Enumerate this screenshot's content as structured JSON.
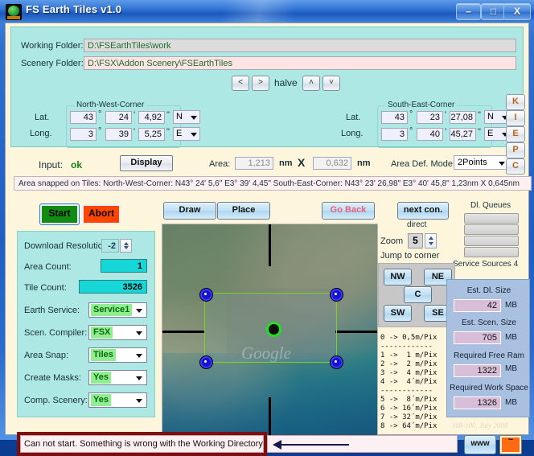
{
  "window": {
    "title": "FS Earth Tiles   v1.0",
    "minimize_label": "–",
    "maximize_label": "□",
    "close_label": "X"
  },
  "folders": {
    "working_label": "Working Folder:",
    "working_value": "D:\\FSEarthTiles\\work",
    "scenery_label": "Scenery Folder:",
    "scenery_value": "D:\\FSX\\Addon Scenery\\FSEarthTiles"
  },
  "halve": {
    "left": "<",
    "right": ">",
    "label": "halve",
    "up": "˄",
    "down": "˅"
  },
  "nw_corner": {
    "legend": "North-West-Corner",
    "lat_label": "Lat.",
    "long_label": "Long.",
    "lat_deg": "43",
    "lat_min": "24",
    "lat_sec": "4,92",
    "lat_hemi": "N",
    "long_deg": "3",
    "long_min": "39",
    "long_sec": "5,25",
    "long_hemi": "E",
    "deg_sym": "°",
    "min_sym": "'",
    "sec_sym": "\""
  },
  "se_corner": {
    "legend": "South-East-Corner",
    "lat_label": "Lat.",
    "long_label": "Long.",
    "lat_deg": "43",
    "lat_min": "23",
    "lat_sec": "27,08",
    "lat_hemi": "N",
    "long_deg": "3",
    "long_min": "40",
    "long_sec": "45,27",
    "long_hemi": "E",
    "deg_sym": "°",
    "min_sym": "'",
    "sec_sym": "\""
  },
  "input_row": {
    "input_label": "Input:",
    "input_value": "ok",
    "display_button": "Display",
    "area_label": "Area:",
    "area_width": "1,213",
    "unit1": "nm",
    "times": "X",
    "area_height": "0,632",
    "unit2": "nm",
    "mode_label": "Area Def. Mode:",
    "mode_value": "2Points"
  },
  "side_letters": [
    "K",
    "I",
    "E",
    "P",
    "C"
  ],
  "snapped_info": "Area snapped on Tiles:  North-West-Corner: N43° 24' 5,6\"  E3° 39' 4,45\"   South-East-Corner: N43° 23' 26,98\"  E3° 40' 45,8\"   1,23nm X 0,645nm",
  "actions": {
    "start": "Start",
    "abort": "Abort",
    "draw": "Draw",
    "place": "Place",
    "go_back": "Go Back",
    "next_con": "next con.",
    "direct": "direct"
  },
  "queues": {
    "label": "Dl. Queues",
    "service_sources": "Service Sources 4"
  },
  "settings": {
    "download_resolution_label": "Download Resolution:",
    "download_resolution_value": "-2",
    "area_count_label": "Area Count:",
    "area_count_value": "1",
    "tile_count_label": "Tile Count:",
    "tile_count_value": "3526",
    "earth_service_label": "Earth Service:",
    "earth_service_value": "Service1",
    "scen_compiler_label": "Scen. Compiler:",
    "scen_compiler_value": "FSX",
    "area_snap_label": "Area Snap:",
    "area_snap_value": "Tiles",
    "create_masks_label": "Create Masks:",
    "create_masks_value": "Yes",
    "comp_scenery_label": "Comp. Scenery:",
    "comp_scenery_value": "Yes"
  },
  "map": {
    "watermark": "Google"
  },
  "zoom_panel": {
    "zoom_label": "Zoom",
    "zoom_value": "5",
    "jump_label": "Jump to corner",
    "nw": "NW",
    "ne": "NE",
    "c": "C",
    "sw": "SW",
    "se": "SE",
    "resolution_legend": "0 -> 0,5m/Pix\n------------\n1 ->  1 m/Pix\n2 ->  2 m/Pix\n3 ->  4 m/Pix\n4 ->  4´m/Pix\n------------\n5 ->  8´m/Pix\n6 -> 16´m/Pix\n7 -> 32´m/Pix\n8 -> 64´m/Pix"
  },
  "estimates": {
    "dl_size_label": "Est. Dl. Size",
    "dl_size_value": "42",
    "scen_size_label": "Est. Scen. Size",
    "scen_size_value": "705",
    "free_ram_label": "Required Free Ram",
    "free_ram_value": "1322",
    "work_space_label": "Required Work Space",
    "work_space_value": "1326",
    "unit": "MB"
  },
  "signature": "HB-100,  July 2008",
  "status": {
    "message": "Can not start. Something is wrong with the Working Directory!",
    "www_button": "www",
    "orange_button": "~"
  },
  "colors": {
    "accent_aqua": "#aee8e4",
    "panel_cream": "#fdf6dc",
    "start_green": "#128b12",
    "abort_orange": "#ff4500",
    "error_frame": "#7a1010",
    "cyan_field": "#16d7d7",
    "combo_green": "#90ee90"
  }
}
